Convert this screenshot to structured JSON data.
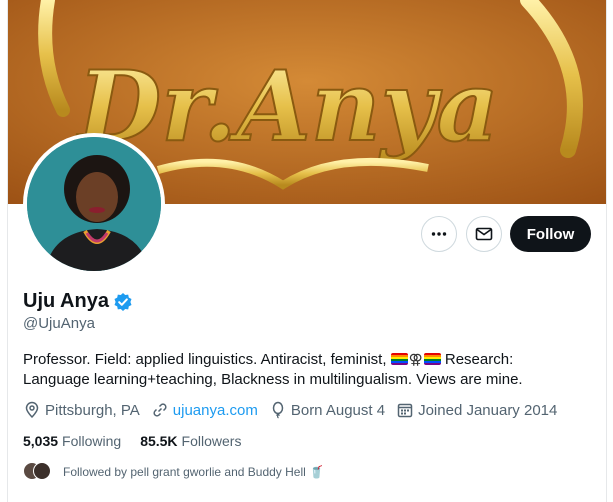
{
  "banner": {
    "text": "Dr.Anya",
    "description_icon": "nameplate-banner"
  },
  "profile": {
    "display_name": "Uju Anya",
    "handle": "@UjuAnya",
    "verified": true,
    "bio_part1": "Professor. Field: applied linguistics. Antiracist, feminist, ",
    "bio_part2": " Research: Language learning+teaching, Blackness in multilingualism. Views are mine.",
    "bio_symbol": "⚢"
  },
  "meta": {
    "location": "Pittsburgh, PA",
    "website": "ujuanya.com",
    "born": "Born August 4",
    "joined": "Joined January 2014"
  },
  "counts": {
    "following_value": "5,035",
    "following_label": "Following",
    "followers_value": "85.5K",
    "followers_label": "Followers"
  },
  "followed_by": "Followed by pell grant gworlie and Buddy Hell 🥤",
  "actions": {
    "follow_label": "Follow"
  },
  "colors": {
    "accent": "#1d9bf0",
    "follow_bg": "#0f1419",
    "muted": "#536471"
  },
  "icons": [
    "more-icon",
    "mail-icon",
    "verified-badge-icon",
    "location-icon",
    "link-icon",
    "balloon-icon",
    "calendar-icon"
  ]
}
